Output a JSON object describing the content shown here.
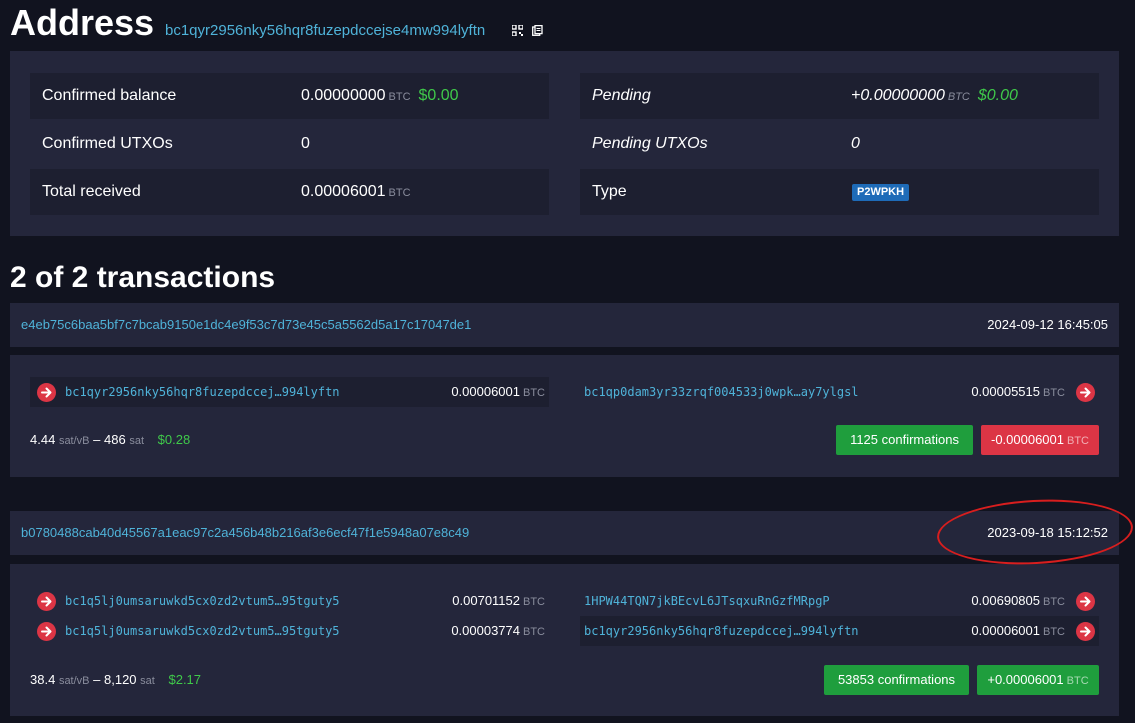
{
  "header": {
    "title": "Address",
    "address": "bc1qyr2956nky56hqr8fuzepdccejse4mw994lyftn"
  },
  "summary": {
    "left": [
      {
        "label": "Confirmed balance",
        "value": "0.00000000",
        "unit": "BTC",
        "usd": "$0.00"
      },
      {
        "label": "Confirmed UTXOs",
        "value": "0"
      },
      {
        "label": "Total received",
        "value": "0.00006001",
        "unit": "BTC"
      }
    ],
    "right": [
      {
        "label": "Pending",
        "value": "+0.00000000",
        "unit": "BTC",
        "usd": "$0.00"
      },
      {
        "label": "Pending UTXOs",
        "value": "0"
      },
      {
        "label": "Type",
        "badge": "P2WPKH"
      }
    ]
  },
  "transactions_heading": "2 of 2 transactions",
  "transactions": [
    {
      "txid": "e4eb75c6baa5bf7c7bcab9150e1dc4e9f53c7d73e45c5a5562d5a17c17047de1",
      "time": "2024-09-12 16:45:05",
      "inputs": [
        {
          "address": "bc1qyr2956nky56hqr8fuzepdccej…994lyftn",
          "amount": "0.00006001",
          "unit": "BTC"
        }
      ],
      "outputs": [
        {
          "address": "bc1qp0dam3yr33zrqf004533j0wpk…ay7ylgsl",
          "amount": "0.00005515",
          "unit": "BTC"
        }
      ],
      "fee_rate": "4.44",
      "fee_rate_unit": "sat/vB",
      "fee_sep": "–",
      "fee": "486",
      "fee_unit": "sat",
      "fee_usd": "$0.28",
      "confirmations": "1125 confirmations",
      "net_amount": "-0.00006001",
      "net_unit": "BTC",
      "colors": {
        "net": "#dc3545"
      }
    },
    {
      "txid": "b0780488cab40d45567a1eac97c2a456b48b216af3e6ecf47f1e5948a07e8c49",
      "time": "2023-09-18 15:12:52",
      "inputs": [
        {
          "address": "bc1q5lj0umsaruwkd5cx0zd2vtum5…95tguty5",
          "amount": "0.00701152",
          "unit": "BTC"
        },
        {
          "address": "bc1q5lj0umsaruwkd5cx0zd2vtum5…95tguty5",
          "amount": "0.00003774",
          "unit": "BTC"
        }
      ],
      "outputs": [
        {
          "address": "1HPW44TQN7jkBEcvL6JTsqxuRnGzfMRpgP",
          "amount": "0.00690805",
          "unit": "BTC"
        },
        {
          "address": "bc1qyr2956nky56hqr8fuzepdccej…994lyftn",
          "amount": "0.00006001",
          "unit": "BTC"
        }
      ],
      "fee_rate": "38.4",
      "fee_rate_unit": "sat/vB",
      "fee_sep": "–",
      "fee": "8,120",
      "fee_unit": "sat",
      "fee_usd": "$2.17",
      "confirmations": "53853 confirmations",
      "net_amount": "+0.00006001",
      "net_unit": "BTC",
      "colors": {
        "net": "#1f9e3d"
      }
    }
  ],
  "colors": {
    "background": "#11131f",
    "panel": "#24263b",
    "link": "#4fb3d9",
    "usd_green": "#3fc94a",
    "arrow_red": "#dc3545",
    "annotation": "#d81e1e"
  },
  "icons": [
    "qr-code-icon",
    "copy-icon",
    "arrow-right-circle-icon"
  ]
}
